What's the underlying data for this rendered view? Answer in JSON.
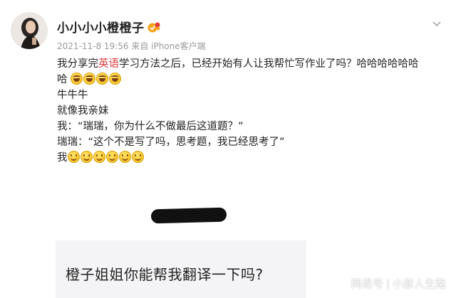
{
  "post": {
    "author": "小小小小橙橙子",
    "meta": "2021-11-8 19:56 来自 iPhone客户端",
    "lines": [
      {
        "before": "我分享完",
        "highlight": "英语",
        "after": "学习方法之后，已经开始有人让我帮忙写作业了吗？哈哈哈哈哈哈"
      },
      {
        "text": "哈"
      },
      {
        "text": "牛牛牛"
      },
      {
        "text": "就像我亲妹"
      },
      {
        "text": "我：“瑞瑞，你为什么不做最后这道题？”"
      },
      {
        "text": "瑞瑞：“这个不是写了吗，思考题，我已经思考了”"
      },
      {
        "text": "我"
      }
    ],
    "laugh_emoji_count": 4,
    "smile_emoji_count": 6
  },
  "image": {
    "card_text": "橙子姐姐你能帮我翻译一下吗?"
  },
  "watermark": {
    "left": "网易号",
    "sep": "|",
    "right": "小彦人生路"
  },
  "icons": {
    "avatar": "avatar-photo",
    "verified": "verified-badge-icon",
    "more": "chevron-down-icon"
  },
  "colors": {
    "highlight": "#e2383c",
    "meta": "#9a9a9a",
    "card_bg": "#f4f4f6"
  }
}
